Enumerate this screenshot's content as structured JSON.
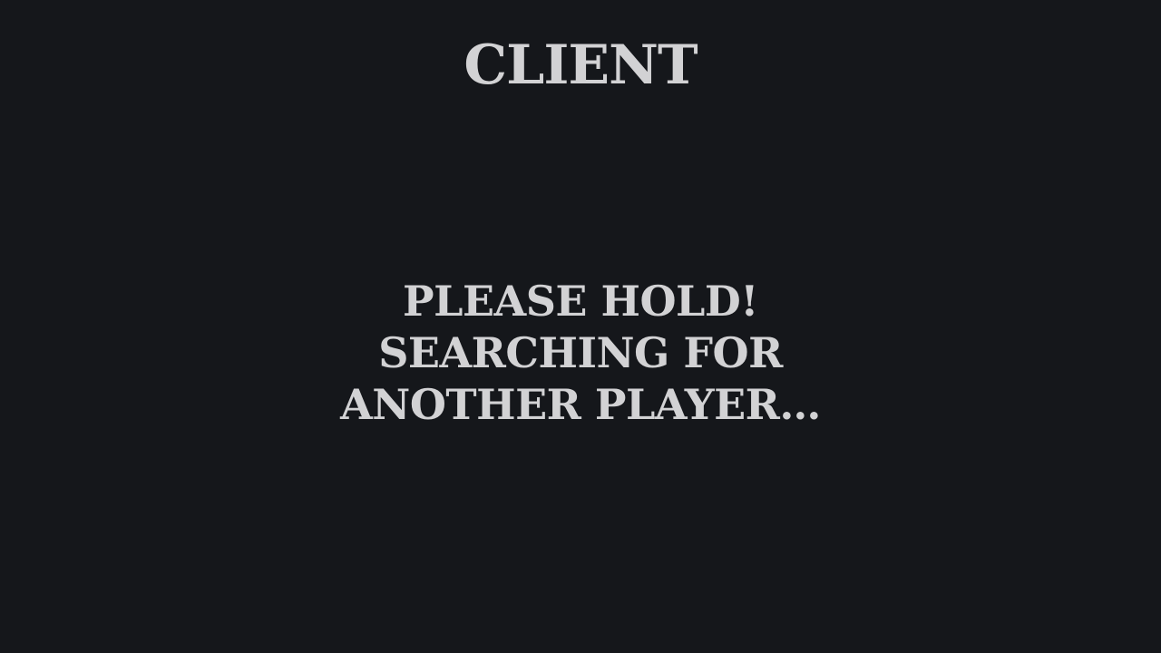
{
  "header": {
    "title": "CLIENT"
  },
  "status": {
    "lines": [
      "PLEASE HOLD!",
      "SEARCHING FOR",
      "ANOTHER PLAYER…"
    ]
  },
  "colors": {
    "background": "#15171b",
    "text": "#d2d2d4"
  }
}
